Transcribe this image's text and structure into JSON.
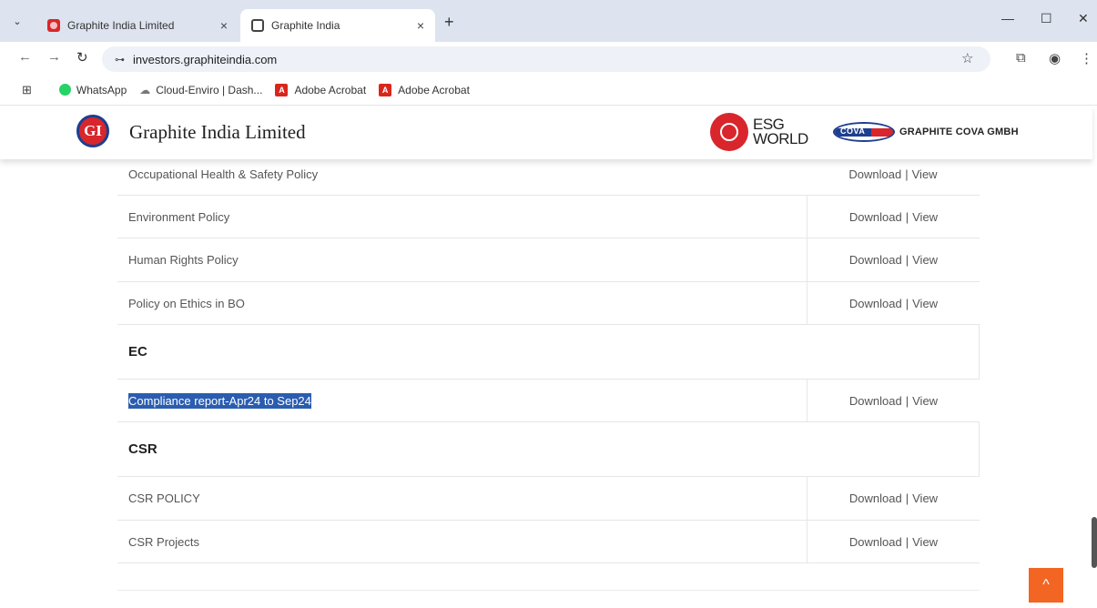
{
  "browser": {
    "tabs": [
      {
        "title": "Graphite India Limited",
        "active": false
      },
      {
        "title": "Graphite India",
        "active": true
      }
    ],
    "url": "investors.graphiteindia.com",
    "bookmarks": [
      {
        "label": "WhatsApp"
      },
      {
        "label": "Cloud-Enviro | Dash..."
      },
      {
        "label": "Adobe Acrobat"
      },
      {
        "label": "Adobe Acrobat"
      }
    ],
    "glyphs": {
      "dropdown": "⌄",
      "close": "×",
      "new_tab": "+",
      "minimize": "—",
      "maximize": "☐",
      "win_close": "✕",
      "back": "←",
      "forward": "→",
      "reload": "↻",
      "tune": "⊶",
      "star": "☆",
      "extensions": "⧉",
      "profile": "◉",
      "menu": "⋮",
      "apps": "⊞",
      "cloud": "☁",
      "pdf": "A"
    }
  },
  "header": {
    "logo_text": "GI",
    "company_name": "Graphite India Limited",
    "esg_line1": "ESG",
    "esg_line2": "WORLD",
    "cova_logo_text": "COVA",
    "cova_name": "GRAPHITE COVA GMBH"
  },
  "download_label": "Download",
  "view_label": "View",
  "separator": "|",
  "rows_top": [
    {
      "label": "Occupational Health & Safety Policy"
    },
    {
      "label": "Environment Policy"
    },
    {
      "label": "Human Rights Policy"
    },
    {
      "label": "Policy on Ethics in BO"
    }
  ],
  "section_ec": {
    "heading": "EC",
    "rows": [
      {
        "label": "Compliance report-Apr24 to Sep24",
        "selected": true
      }
    ]
  },
  "section_csr": {
    "heading": "CSR",
    "rows": [
      {
        "label": "CSR POLICY"
      },
      {
        "label": "CSR Projects"
      }
    ]
  },
  "scroll_top_glyph": "^"
}
